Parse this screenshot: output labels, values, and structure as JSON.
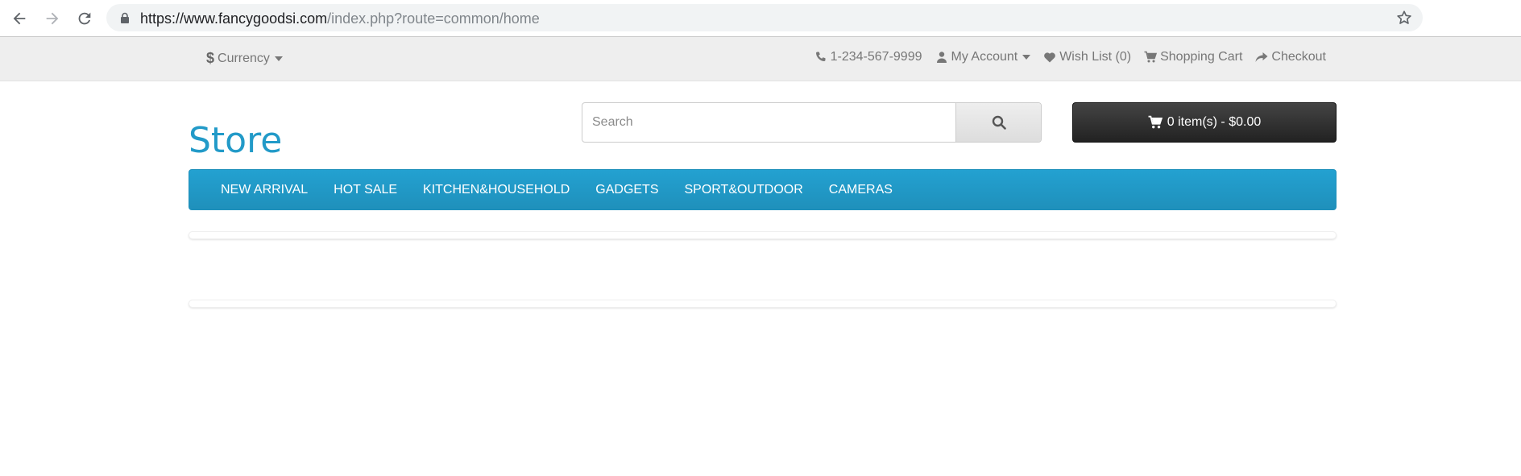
{
  "browser": {
    "url_host": "https://www.fancygoodsi.com",
    "url_path": "/index.php?route=common/home",
    "icons": [
      "back-arrow-icon",
      "forward-arrow-icon",
      "reload-icon",
      "lock-icon",
      "star-icon"
    ]
  },
  "topbar": {
    "currency_symbol": "$",
    "currency_label": "Currency",
    "phone": "1-234-567-9999",
    "account": "My Account",
    "wishlist": "Wish List (0)",
    "cart": "Shopping Cart",
    "checkout": "Checkout"
  },
  "header": {
    "logo": "Store",
    "search_placeholder": "Search",
    "cart_button": "0 item(s) - $0.00"
  },
  "menu": {
    "items": [
      "NEW ARRIVAL",
      "HOT SALE",
      "KITCHEN&HOUSEHOLD",
      "GADGETS",
      "SPORT&OUTDOOR",
      "CAMERAS"
    ]
  },
  "colors": {
    "accent": "#229ac8",
    "menu_bg": "#229ac8",
    "cart_bg": "#303030",
    "topbar_bg": "#eeeeee"
  }
}
